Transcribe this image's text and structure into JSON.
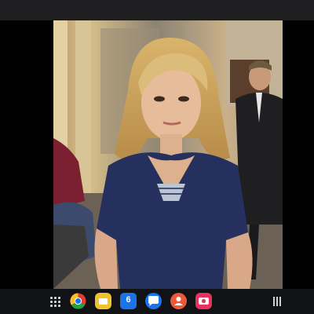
{
  "window": {
    "title": ""
  },
  "video": {
    "description_hidden": true
  },
  "taskbar": {
    "icons": [
      {
        "name": "apps-launcher-icon",
        "label": ""
      },
      {
        "name": "chrome-icon",
        "label": ""
      },
      {
        "name": "files-icon",
        "label": ""
      },
      {
        "name": "calendar-icon",
        "label": "6"
      },
      {
        "name": "messages-icon",
        "label": ""
      },
      {
        "name": "contacts-icon",
        "label": ""
      },
      {
        "name": "camera-icon",
        "label": ""
      },
      {
        "name": "recents-icon",
        "label": ""
      }
    ],
    "calendar_day": "6",
    "colors": {
      "chrome": "#e33b2e",
      "files": "#f3c12b",
      "calendar": "#1a73e8",
      "messages": "#1a73e8",
      "contacts": "#ea5a3a",
      "camera": "#e8315b"
    }
  }
}
